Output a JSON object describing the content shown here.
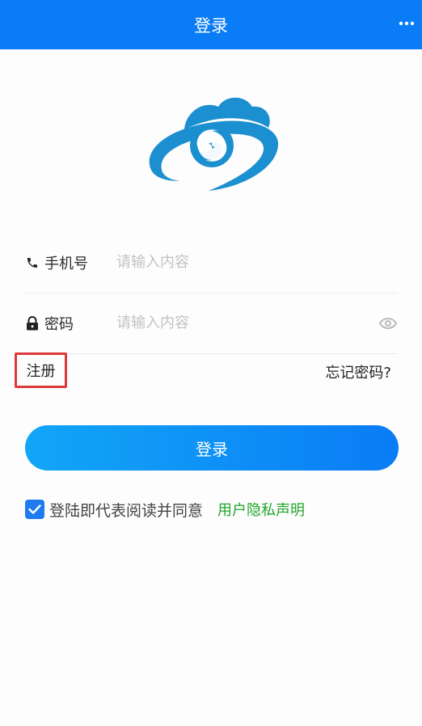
{
  "header": {
    "title": "登录"
  },
  "form": {
    "phone_label": "手机号",
    "phone_placeholder": "请输入内容",
    "phone_value": "",
    "password_label": "密码",
    "password_placeholder": "请输入内容",
    "password_value": ""
  },
  "links": {
    "register": "注册",
    "forgot_password": "忘记密码?"
  },
  "login_button": "登录",
  "agreement": {
    "checked": true,
    "text": "登陆即代表阅读并同意",
    "link": "用户隐私声明"
  },
  "colors": {
    "primary": "#0a7cf5",
    "logo": "#1c8fd0",
    "link_green": "#22a52a",
    "highlight": "#dc3a3a"
  },
  "icons": [
    "more-icon",
    "phone-icon",
    "lock-icon",
    "eye-icon",
    "check-icon"
  ]
}
